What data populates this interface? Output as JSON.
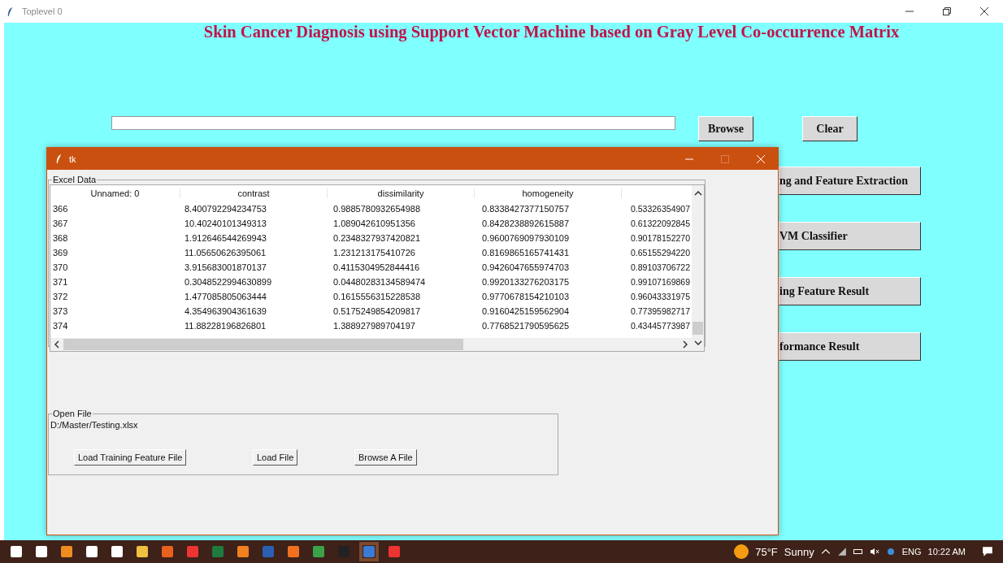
{
  "window": {
    "title": "Toplevel 0"
  },
  "heading": "Skin Cancer Diagnosis using Support Vector Machine based on Gray Level Co-occurrence Matrix",
  "path_field": {
    "kind": "entry"
  },
  "top_buttons": [
    "Browse",
    "Clear"
  ],
  "side_buttons": [
    "ng and Feature Extraction",
    "VM Classifier",
    "ing Feature Result",
    "formance Result"
  ],
  "dialog": {
    "title": "tk",
    "excel_frame": {
      "label": "Excel Data",
      "table": {
        "columns": [
          "Unnamed: 0",
          "contrast",
          "dissimilarity",
          "homogeneity",
          ""
        ],
        "rows": [
          [
            "366",
            "8.400792294234753",
            "0.9885780932654988",
            "0.8338427377150757",
            "0.53326354907"
          ],
          [
            "367",
            "10.40240101349313",
            "1.089042610951356",
            "0.8428238892615887",
            "0.61322092845"
          ],
          [
            "368",
            "1.912646544269943",
            "0.2348327937420821",
            "0.9600769097930109",
            "0.90178152270"
          ],
          [
            "369",
            "11.05650626395061",
            "1.231213175410726",
            "0.8169865165741431",
            "0.65155294220"
          ],
          [
            "370",
            "3.915683001870137",
            "0.4115304952844416",
            "0.9426047655974703",
            "0.89103706722"
          ],
          [
            "371",
            "0.3048522994630899",
            "0.04480283134589474",
            "0.9920133276203175",
            "0.99107169869"
          ],
          [
            "372",
            "1.477085805063444",
            "0.1615556315228538",
            "0.9770678154210103",
            "0.96043331975"
          ],
          [
            "373",
            "4.354963904361639",
            "0.5175249854209817",
            "0.9160425159562904",
            "0.77395982717"
          ],
          [
            "374",
            "11.88228196826801",
            "1.388927989704197",
            "0.7768521790595625",
            "0.43445773987"
          ]
        ]
      }
    },
    "open_frame": {
      "label": "Open File",
      "path": "D:/Master/Testing.xlsx",
      "buttons": [
        "Load Training Feature File",
        "Load File",
        "Browse A File"
      ]
    }
  },
  "taskbar": {
    "weather": "75°F",
    "condition": "Sunny",
    "language": "ENG",
    "time": "10:22 AM"
  }
}
